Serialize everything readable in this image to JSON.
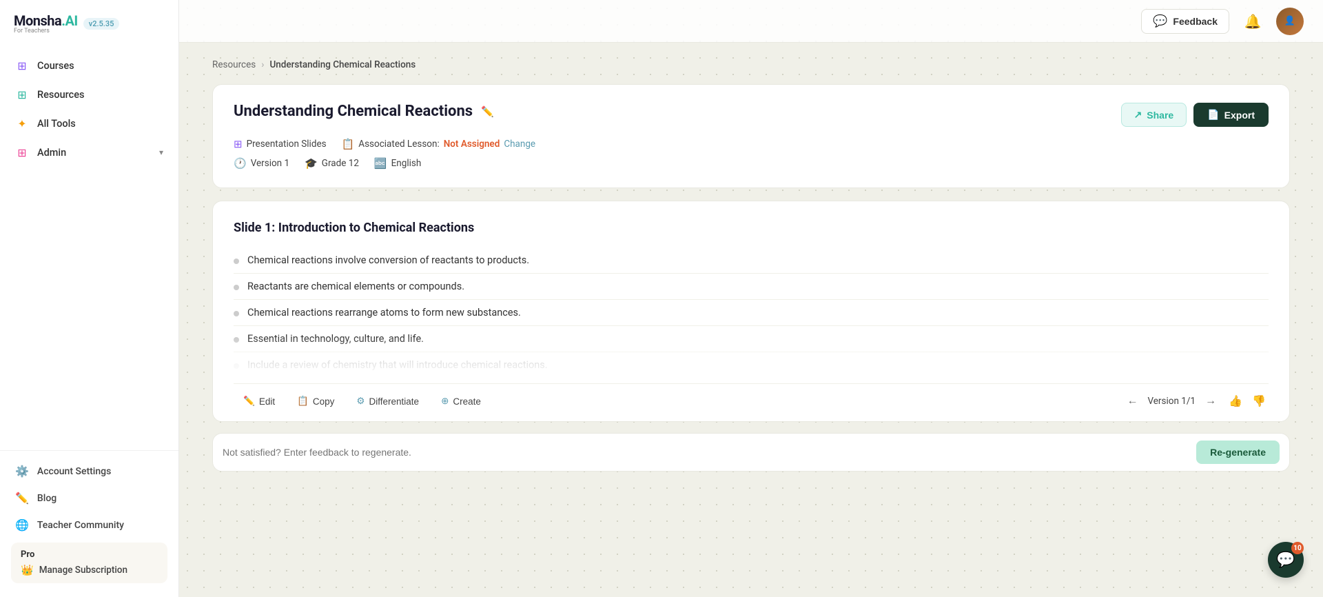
{
  "app": {
    "name": "Monsha",
    "name_ai": ".AI",
    "subtitle": "For Teachers",
    "version": "v2.5.35"
  },
  "sidebar": {
    "nav_items": [
      {
        "id": "courses",
        "label": "Courses",
        "icon": "🟪"
      },
      {
        "id": "resources",
        "label": "Resources",
        "icon": "🟩"
      },
      {
        "id": "all-tools",
        "label": "All Tools",
        "icon": "🟧"
      },
      {
        "id": "admin",
        "label": "Admin",
        "icon": "🟥"
      }
    ],
    "bottom_items": [
      {
        "id": "account-settings",
        "label": "Account Settings",
        "icon": "⚙️"
      },
      {
        "id": "blog",
        "label": "Blog",
        "icon": "✏️"
      },
      {
        "id": "teacher-community",
        "label": "Teacher Community",
        "icon": "🌐"
      }
    ],
    "pro": {
      "label": "Pro",
      "manage_subscription": "Manage Subscription"
    }
  },
  "topbar": {
    "feedback_label": "Feedback",
    "avatar_initials": "U"
  },
  "breadcrumb": {
    "resources": "Resources",
    "separator": "›",
    "current": "Understanding Chemical Reactions"
  },
  "resource": {
    "title": "Understanding Chemical Reactions",
    "type": "Presentation Slides",
    "associated_lesson_label": "Associated Lesson:",
    "associated_lesson_value": "Not Assigned",
    "change_label": "Change",
    "version": "Version 1",
    "grade": "Grade 12",
    "language": "English",
    "share_label": "Share",
    "export_label": "Export"
  },
  "slide": {
    "title": "Slide 1: Introduction to Chemical Reactions",
    "bullets": [
      "Chemical reactions involve conversion of reactants to products.",
      "Reactants are chemical elements or compounds.",
      "Chemical reactions rearrange atoms to form new substances.",
      "Essential in technology, culture, and life.",
      "Include a review of chemistry that will introduce chemical reactions."
    ]
  },
  "toolbar": {
    "edit_label": "Edit",
    "copy_label": "Copy",
    "differentiate_label": "Differentiate",
    "create_label": "Create",
    "version_label": "Version 1/1"
  },
  "feedback": {
    "placeholder": "Not satisfied? Enter feedback to regenerate.",
    "regenerate_label": "Re-generate"
  },
  "chat": {
    "badge_count": "10"
  }
}
